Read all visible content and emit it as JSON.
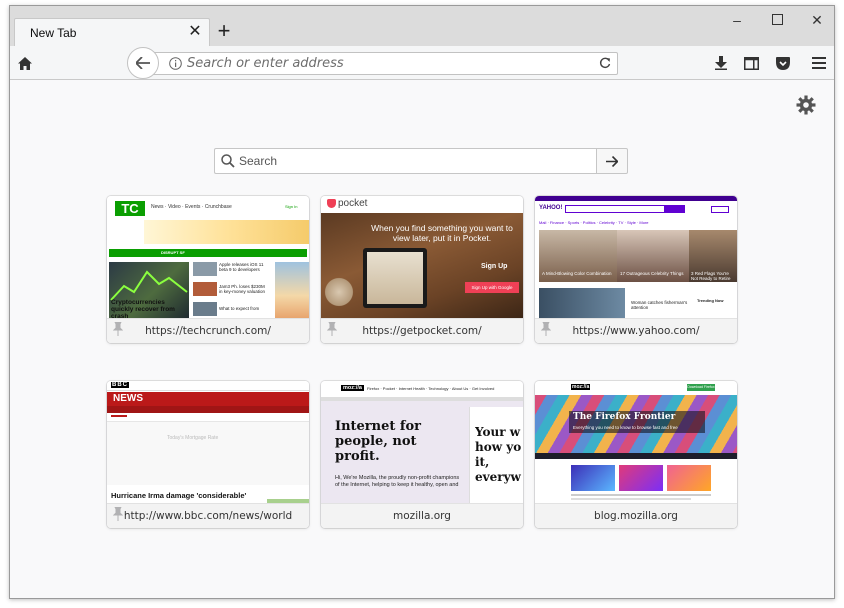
{
  "tab": {
    "title": "New Tab"
  },
  "url_bar": {
    "placeholder": "Search or enter address"
  },
  "search": {
    "placeholder": "Search"
  },
  "tiles": [
    {
      "label": "https://techcrunch.com/",
      "headline": "Cryptocurrencies quickly recover from crash",
      "side1": "Apple releases iOS 11 beta 9 to developers",
      "side2": "Jam3 Ph. loses $230M in key-money valuation",
      "side3": "What to expect from",
      "logo": "TC",
      "nav": "News · Video · Events · Crunchbase",
      "join": "Sign In",
      "disrupt": "DISRUPT SF"
    },
    {
      "label": "https://getpocket.com/",
      "logo": "pocket",
      "headline": "When you find something you want to view later, put it in Pocket.",
      "signup": "Sign Up",
      "google": "Sign Up with Google"
    },
    {
      "label": "https://www.yahoo.com/",
      "logo": "YAHOO!",
      "nav": "Mail · Finance · Sports · Politics · Celebrity · TV · Style · More",
      "s1": "A Mind-Blowing Color Combination",
      "s2": "17 Outrageous Celebrity Things",
      "s3": "3 Red Flags You're Not Ready to Retire",
      "s4": "Woman catches fisherman's attention",
      "trending": "Trending Now"
    },
    {
      "label": "http://www.bbc.com/news/world",
      "logo": "BBC",
      "news": "NEWS",
      "headline": "Hurricane Irma damage 'considerable'",
      "ad": "Today's Mortgage Rate"
    },
    {
      "label": "mozilla.org",
      "logo": "moz://a",
      "headline": "Internet for people, not profit.",
      "body": "Hi, We're Mozilla, the proudly non-profit champions of the Internet, helping to keep it healthy, open and",
      "right": "Your w how yo it, everyw",
      "nav": "Firefox · Pocket · Internet Health · Technology · About Us · Get Involved"
    },
    {
      "label": "blog.mozilla.org",
      "logo": "moz://a",
      "headline": "The Firefox Frontier",
      "sub": "Everything you need to know to browse fast and free",
      "download": "Download Firefox"
    }
  ]
}
